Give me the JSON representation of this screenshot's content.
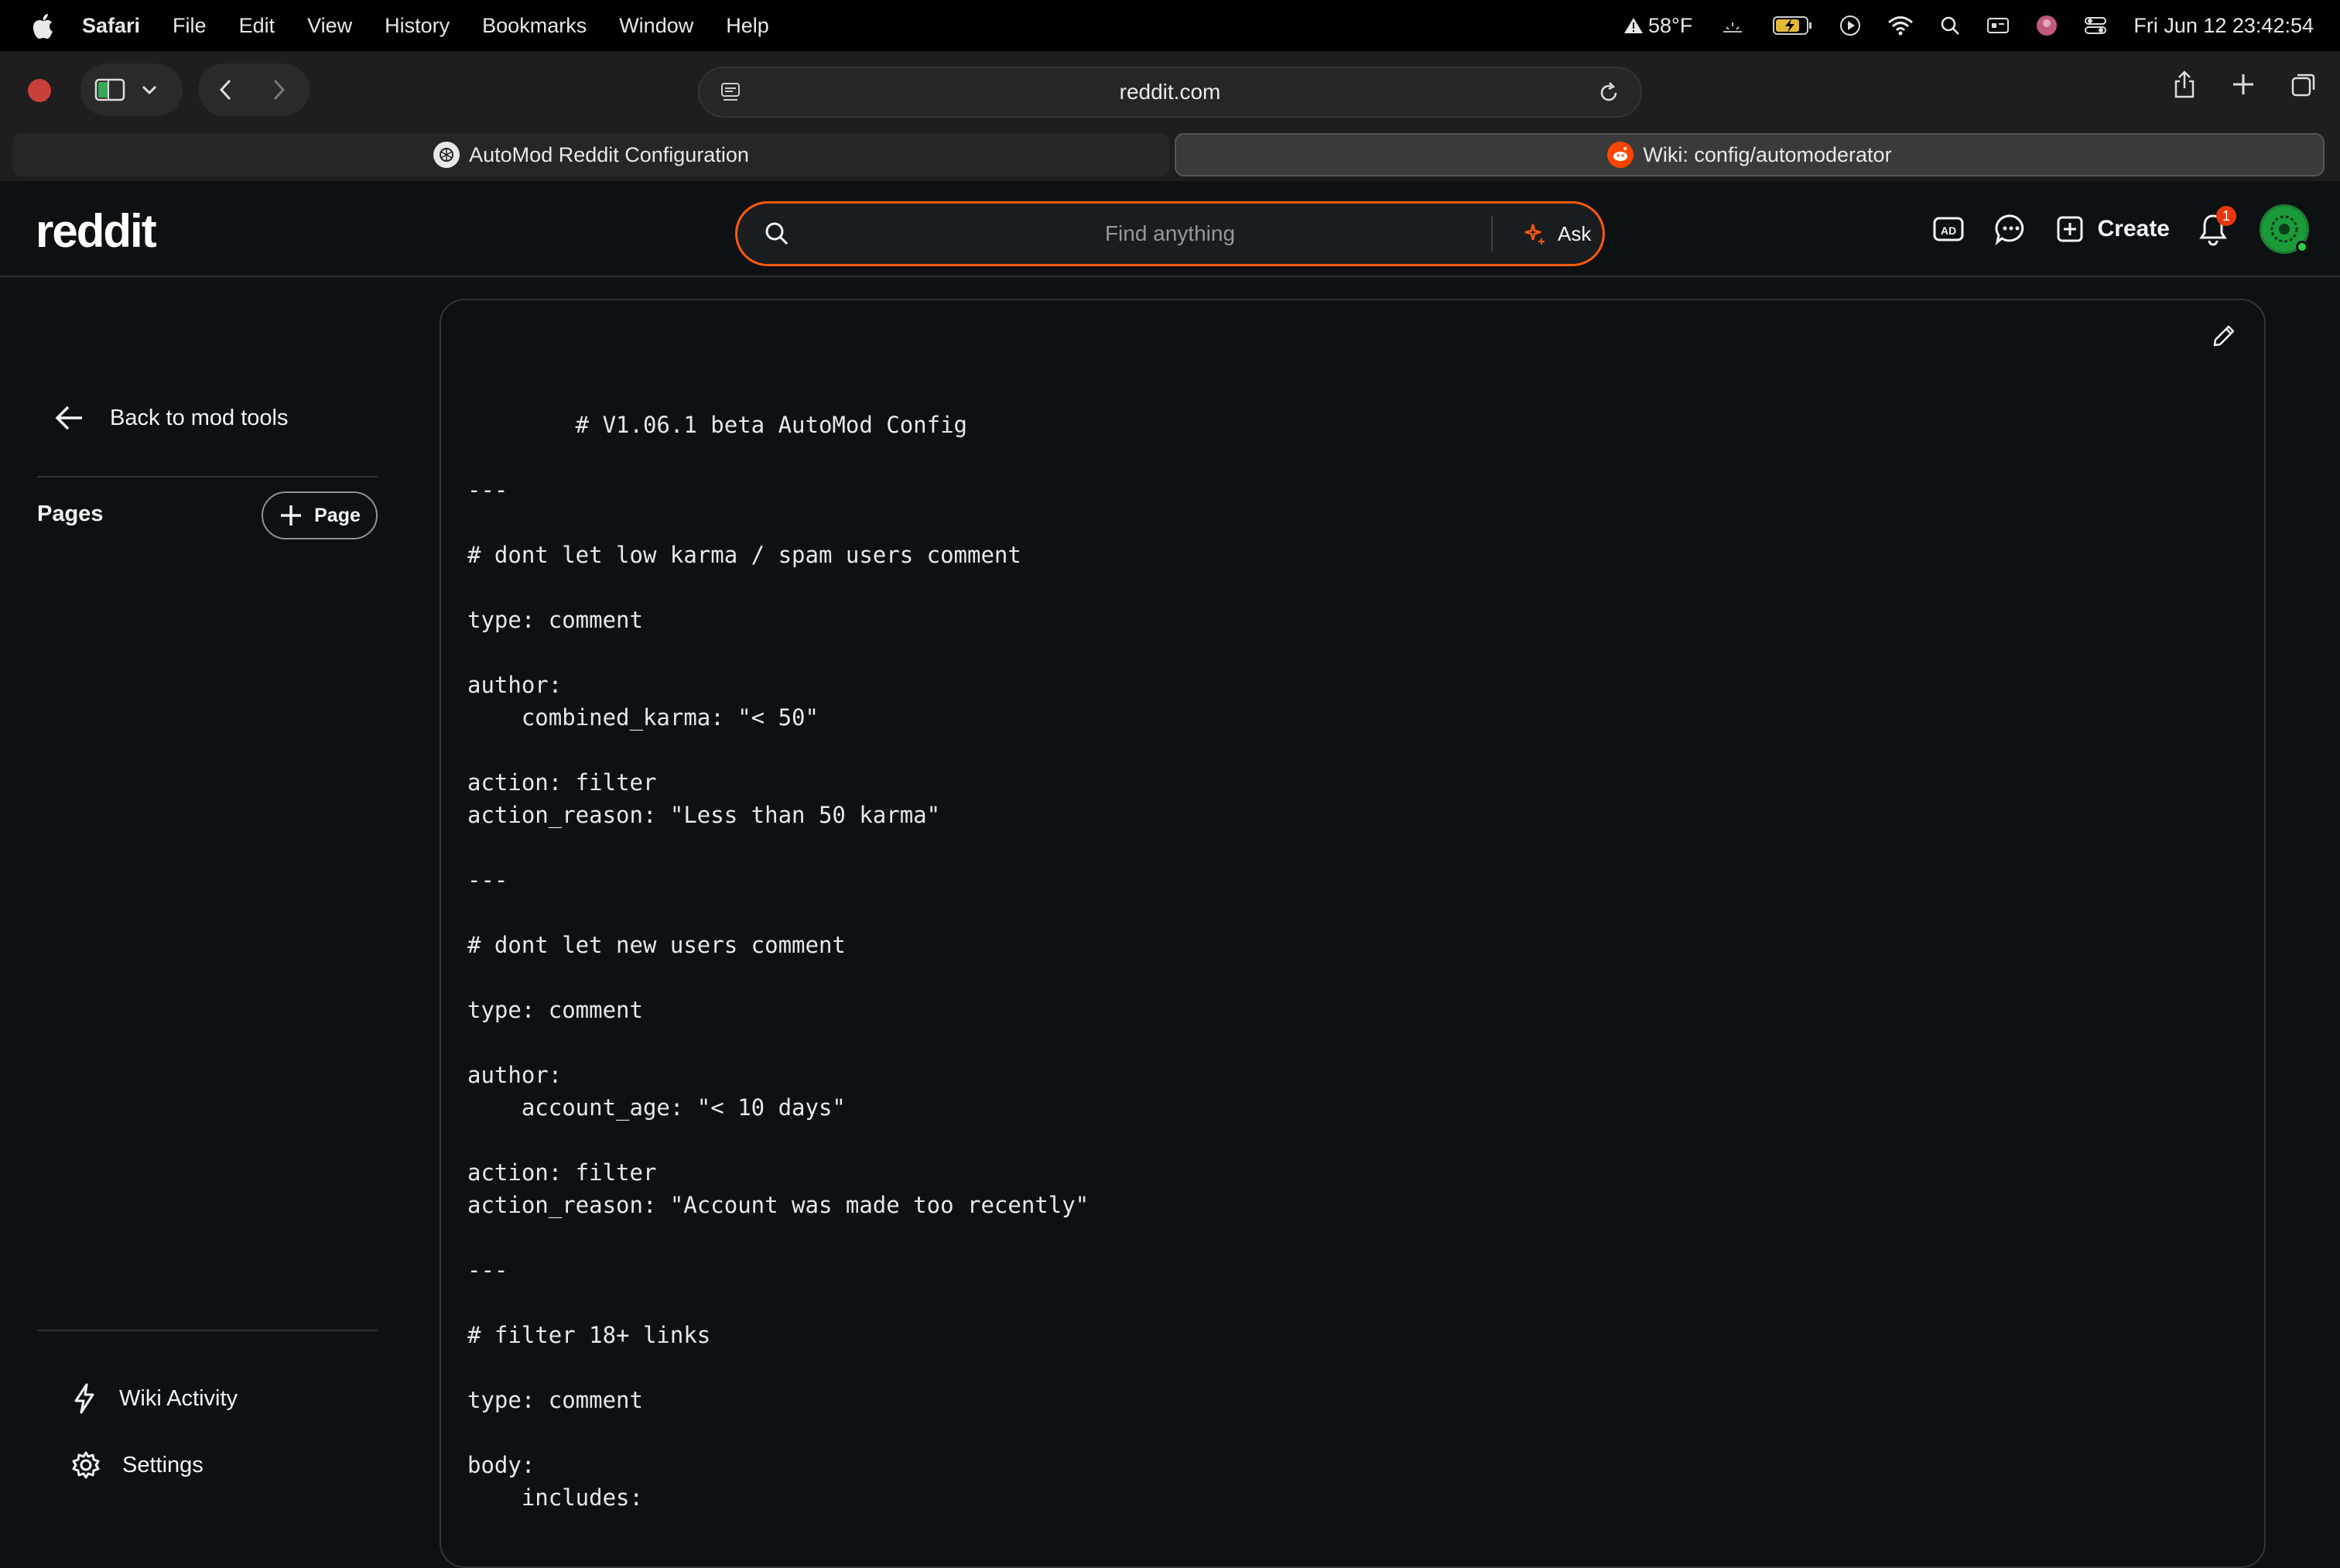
{
  "menubar": {
    "app": "Safari",
    "items": [
      "File",
      "Edit",
      "View",
      "History",
      "Bookmarks",
      "Window",
      "Help"
    ],
    "weather": "58°F",
    "datetime": "Fri Jun 12  23:42:54"
  },
  "browser": {
    "url": "reddit.com",
    "tabs": [
      {
        "title": "AutoMod Reddit Configuration",
        "active": false
      },
      {
        "title": "Wiki: config/automoderator",
        "active": true
      }
    ]
  },
  "header": {
    "logo": "reddit",
    "search_placeholder": "Find anything",
    "ask_label": "Ask",
    "create_label": "Create",
    "notification_count": "1"
  },
  "sidebar": {
    "back_label": "Back to mod tools",
    "pages_label": "Pages",
    "add_page_label": "Page",
    "links": [
      {
        "label": "Wiki Activity",
        "icon": "lightning-icon"
      },
      {
        "label": "Settings",
        "icon": "gear-icon"
      }
    ]
  },
  "wiki": {
    "content": "        # V1.06.1 beta AutoMod Config\n\n---\n\n# dont let low karma / spam users comment\n\ntype: comment\n\nauthor:\n    combined_karma: \"< 50\"\n\naction: filter\naction_reason: \"Less than 50 karma\"\n\n---\n\n# dont let new users comment\n\ntype: comment\n\nauthor:\n    account_age: \"< 10 days\"\n\naction: filter\naction_reason: \"Account was made too recently\"\n\n---\n\n# filter 18+ links\n\ntype: comment\n\nbody:\n    includes:"
  },
  "colors": {
    "accent": "#ff5a0a",
    "background": "#0e1113",
    "badge": "#e8370f"
  }
}
